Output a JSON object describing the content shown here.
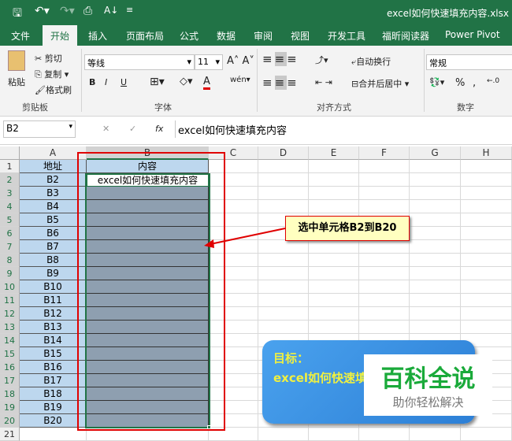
{
  "title_bar": {
    "file_name": "excel如何快速填充内容.xlsx",
    "icons": [
      "save-icon",
      "undo-icon",
      "redo-icon",
      "print-preview-icon",
      "sort-icon",
      "customize-icon"
    ]
  },
  "tabs": [
    "文件",
    "开始",
    "插入",
    "页面布局",
    "公式",
    "数据",
    "审阅",
    "视图",
    "开发工具",
    "福昕阅读器",
    "Power Pivot"
  ],
  "active_tab": "开始",
  "ribbon": {
    "clipboard": {
      "paste": "粘贴",
      "cut": "剪切",
      "copy": "复制",
      "format_painter": "格式刷",
      "label": "剪贴板"
    },
    "font": {
      "name": "等线",
      "size": "11",
      "bold": "B",
      "italic": "I",
      "underline": "U",
      "label": "字体",
      "font_color": "#e00000"
    },
    "alignment": {
      "wrap": "自动换行",
      "merge": "合并后居中",
      "label": "对齐方式"
    },
    "number": {
      "format": "常规",
      "percent": "%",
      "comma": ",",
      "label": "数字"
    }
  },
  "formula_bar": {
    "name_box": "B2",
    "fx": "fx",
    "content": "excel如何快速填充内容"
  },
  "columns": [
    "A",
    "B",
    "C",
    "D",
    "E",
    "F",
    "G",
    "H"
  ],
  "rows": [
    "1",
    "2",
    "3",
    "4",
    "5",
    "6",
    "7",
    "8",
    "9",
    "10",
    "11",
    "12",
    "13",
    "14",
    "15",
    "16",
    "17",
    "18",
    "19",
    "20",
    "21"
  ],
  "col_a": [
    "地址",
    "B2",
    "B3",
    "B4",
    "B5",
    "B6",
    "B7",
    "B8",
    "B9",
    "B10",
    "B11",
    "B12",
    "B13",
    "B14",
    "B15",
    "B16",
    "B17",
    "B18",
    "B19",
    "B20"
  ],
  "col_b_header": "内容",
  "b2": "excel如何快速填充内容",
  "callout": "选中单元格B2到B20",
  "goal_box": {
    "title": "目标：",
    "text": "excel如何快速填充内容"
  },
  "watermark": {
    "title": "百科全说",
    "subtitle": "助你轻松解决"
  },
  "colors": {
    "excel_green": "#217346",
    "selection": "#8e9fb0",
    "col_a_fill": "#bdd7ee",
    "highlight_red": "#e00000",
    "callout_fill": "#ffffc0",
    "goal_blue": "#3a8ee0",
    "goal_text": "#f0f040",
    "watermark_green": "#1aaa3a"
  }
}
